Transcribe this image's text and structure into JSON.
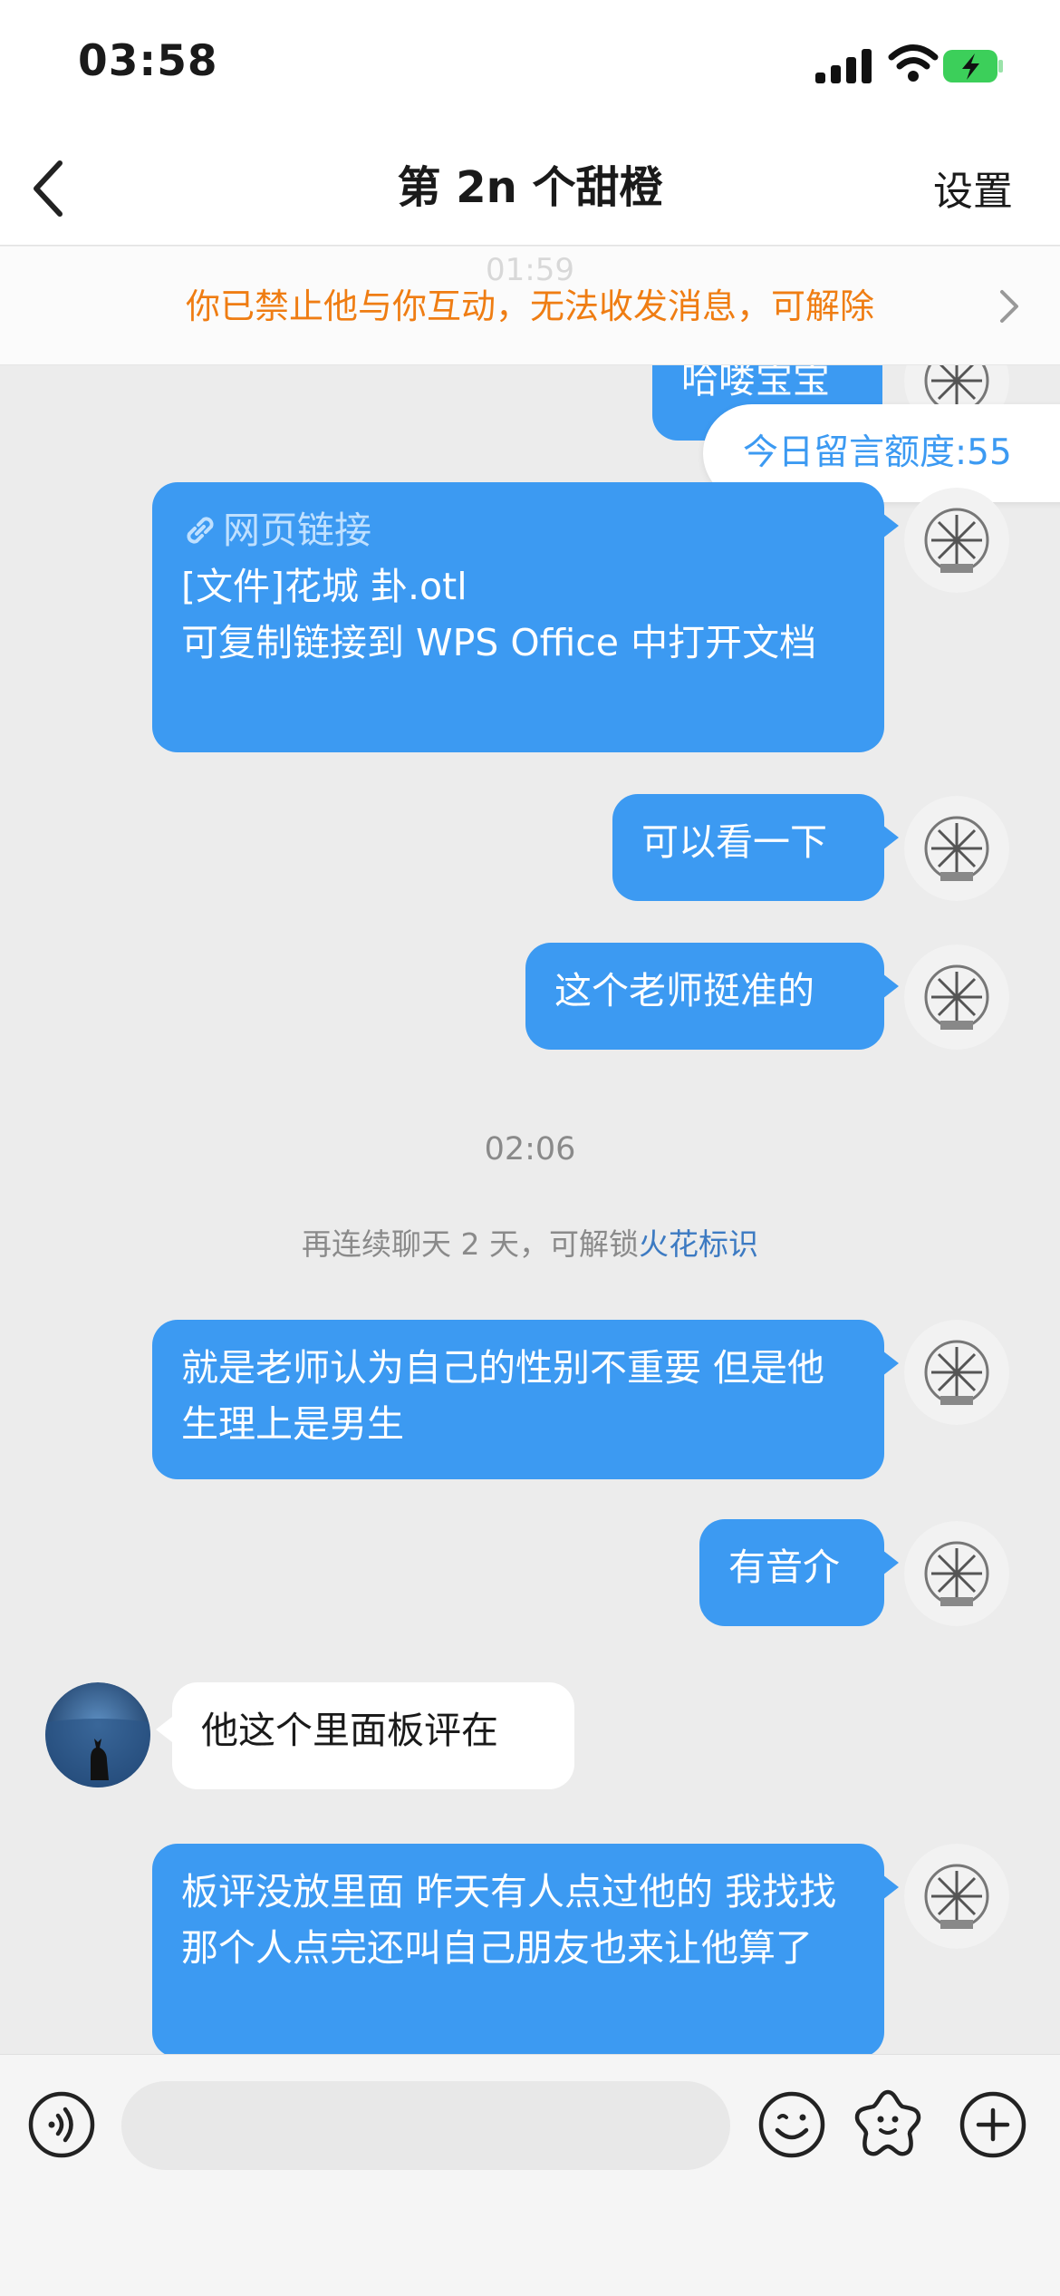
{
  "status_bar": {
    "time": "03:58"
  },
  "nav": {
    "title": "第 2n 个甜橙",
    "settings": "设置"
  },
  "banner": {
    "faded_time": "01:59",
    "text": "你已禁止他与你互动，无法收发消息，可解除"
  },
  "quota": {
    "text": "今日留言额度:55"
  },
  "messages": {
    "m0": "哈喽宝宝",
    "m1": {
      "link_label": "网页链接",
      "line1": "[文件]花城 卦.otl",
      "line2": "可复制链接到 WPS Office 中打开文档"
    },
    "m2": "可以看一下",
    "m3": "这个老师挺准的",
    "time2": "02:06",
    "sys": {
      "prefix": "再连续聊天 2 天，可解锁",
      "highlight": "火花标识"
    },
    "m4": "就是老师认为自己的性别不重要 但是他生理上是男生",
    "m5": "有音介",
    "m6": "他这个里面板评在",
    "m7": "板评没放里面 昨天有人点过他的 我找找 那个人点完还叫自己朋友也来让他算了"
  },
  "colors": {
    "accent_blue": "#3c9af2",
    "banner_orange": "#ef7d13",
    "highlight_blue": "#3c7ac2",
    "background": "#ececec"
  },
  "icons": {
    "back": "chevron-left-icon",
    "banner_more": "chevron-right-icon",
    "link": "link-icon",
    "voice": "voice-icon",
    "emoji": "emoji-icon",
    "sticker": "sticker-icon",
    "plus": "plus-icon"
  }
}
